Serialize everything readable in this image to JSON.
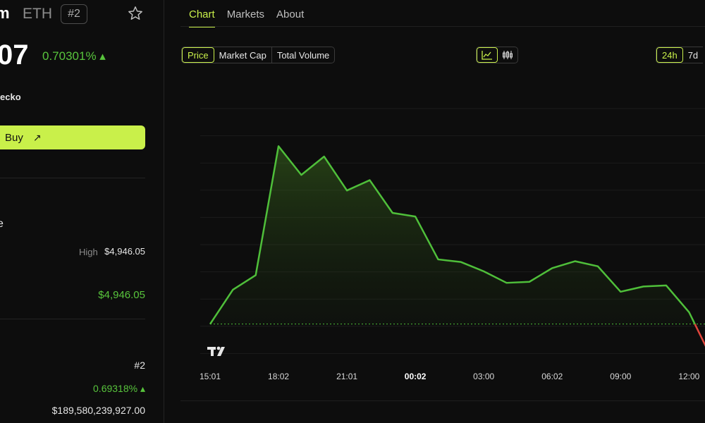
{
  "coin": {
    "name_partial": "m",
    "symbol": "ETH",
    "rank_badge": "#2",
    "price_partial": "07",
    "change_24h": "0.70301% ▴",
    "source_partial": "ecko",
    "buy_label": "Buy",
    "section_partial": "e"
  },
  "stats": {
    "high_label": "High",
    "high_value": "$4,946.05",
    "green_value": "$4,946.05",
    "rank_value": "#2",
    "pct_value": "0.69318% ▴",
    "market_cap_value": "$189,580,239,927.00"
  },
  "tabs": [
    {
      "label": "Chart",
      "active": true
    },
    {
      "label": "Markets",
      "active": false
    },
    {
      "label": "About",
      "active": false
    }
  ],
  "metric_options": [
    "Price",
    "Market Cap",
    "Total Volume"
  ],
  "range_options": [
    "24h",
    "7d"
  ],
  "colors": {
    "accent": "#c9f04a",
    "up": "#58c43c",
    "down": "#e0453c",
    "background": "#0d0d0d"
  },
  "icons": {
    "star": "star-icon",
    "buy_arrow": "arrow-up-right-icon",
    "line_chart": "line-chart-icon",
    "candlestick": "candlestick-icon",
    "tradingview": "tradingview-logo"
  },
  "chart_data": {
    "type": "area",
    "x_tick_labels": [
      "15:01",
      "18:02",
      "21:01",
      "00:02",
      "03:00",
      "06:02",
      "09:00",
      "12:00"
    ],
    "x_tick_index": [
      0,
      3,
      6,
      9,
      12,
      15,
      18,
      21
    ],
    "bold_tick": "00:02",
    "values": [
      0.0,
      1.7,
      2.42,
      8.8,
      7.38,
      8.29,
      6.61,
      7.12,
      5.5,
      5.32,
      3.2,
      3.07,
      2.61,
      2.04,
      2.09,
      2.77,
      3.11,
      2.86,
      1.6,
      1.86,
      1.91,
      0.59,
      -1.71
    ],
    "baseline": 0.0,
    "ylim": [
      -3.5,
      11.5
    ],
    "grid": true,
    "baseline_dotted": true,
    "title": "",
    "xlabel": "",
    "ylabel": ""
  }
}
